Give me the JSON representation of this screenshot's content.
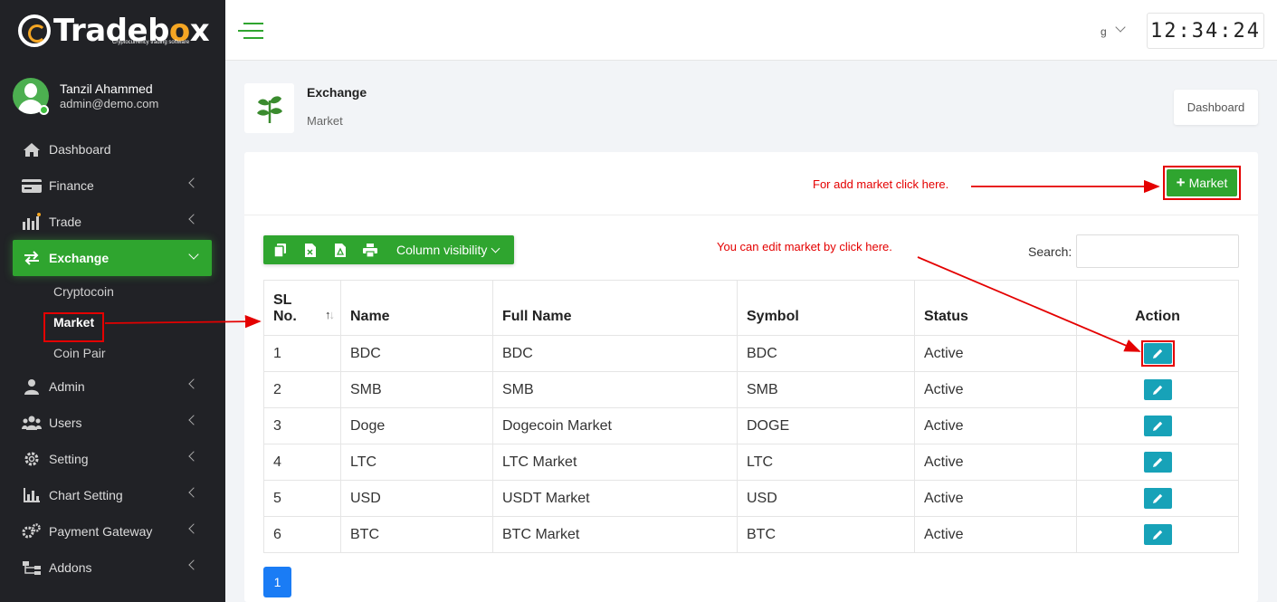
{
  "brand": {
    "name_part1": "Trade",
    "name_part2": "b",
    "name_part3": "o",
    "name_part4": "x",
    "tagline": "Cryptocurrency trading software"
  },
  "user": {
    "name": "Tanzil Ahammed",
    "email": "admin@demo.com"
  },
  "nav": {
    "dashboard": "Dashboard",
    "finance": "Finance",
    "trade": "Trade",
    "exchange": "Exchange",
    "exchange_sub": [
      "Cryptocoin",
      "Market",
      "Coin Pair"
    ],
    "admin": "Admin",
    "users": "Users",
    "setting": "Setting",
    "chart_setting": "Chart Setting",
    "payment_gateway": "Payment Gateway",
    "addons": "Addons"
  },
  "header": {
    "lang": "g",
    "clock": "12:34:24"
  },
  "page": {
    "title": "Exchange",
    "subtitle": "Market",
    "dashboard_btn": "Dashboard"
  },
  "card": {
    "add_btn": "Market",
    "column_visibility": "Column visibility",
    "search_label": "Search:",
    "search_value": ""
  },
  "table": {
    "headers": {
      "sl_line1": "SL",
      "sl_line2": "No.",
      "name": "Name",
      "full_name": "Full Name",
      "symbol": "Symbol",
      "status": "Status",
      "action": "Action"
    },
    "rows": [
      {
        "sl": "1",
        "name": "BDC",
        "full_name": "BDC",
        "symbol": "BDC",
        "status": "Active"
      },
      {
        "sl": "2",
        "name": "SMB",
        "full_name": "SMB",
        "symbol": "SMB",
        "status": "Active"
      },
      {
        "sl": "3",
        "name": "Doge",
        "full_name": "Dogecoin Market",
        "symbol": "DOGE",
        "status": "Active"
      },
      {
        "sl": "4",
        "name": "LTC",
        "full_name": "LTC Market",
        "symbol": "LTC",
        "status": "Active"
      },
      {
        "sl": "5",
        "name": "USD",
        "full_name": "USDT Market",
        "symbol": "USD",
        "status": "Active"
      },
      {
        "sl": "6",
        "name": "BTC",
        "full_name": "BTC Market",
        "symbol": "BTC",
        "status": "Active"
      }
    ]
  },
  "pagination": {
    "current": "1"
  },
  "annotations": {
    "add_market": "For add market click here.",
    "edit_market": "You can edit market by click here."
  },
  "colors": {
    "accent": "#2fa52f",
    "sidebar": "#212226",
    "edit": "#17a2b8",
    "annotation": "#e40000",
    "page_active": "#1a7cf5"
  }
}
